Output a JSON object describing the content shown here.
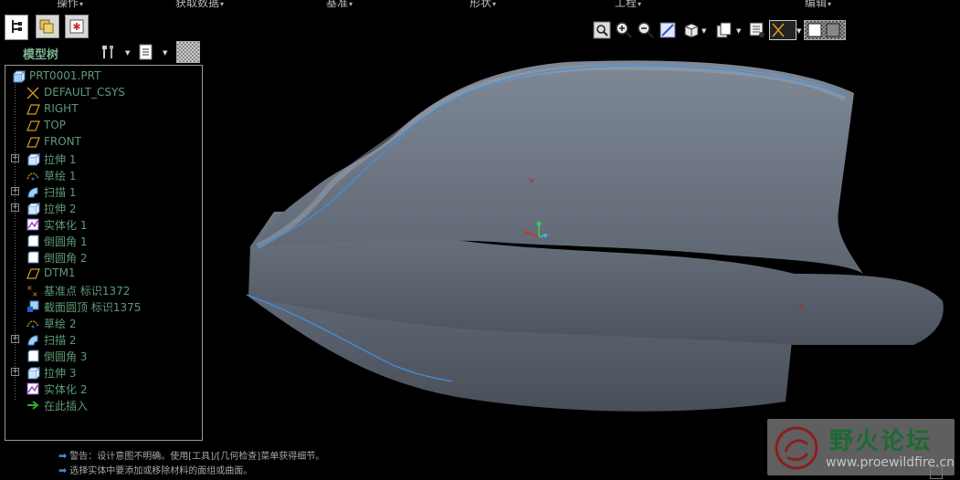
{
  "menu": [
    {
      "label": "操作"
    },
    {
      "label": "获取数据"
    },
    {
      "label": "基准"
    },
    {
      "label": "形状"
    },
    {
      "label": "工程"
    },
    {
      "label": "编辑"
    }
  ],
  "panel": {
    "title": "模型树",
    "tabs": [
      "model-tree-tab",
      "folder-browser-tab",
      "favorites-tab"
    ]
  },
  "tree": [
    {
      "label": "PRT0001.PRT",
      "icon": "part-icon",
      "expander": false,
      "indent": 0
    },
    {
      "label": "DEFAULT_CSYS",
      "icon": "csys-icon",
      "expander": false,
      "indent": 1
    },
    {
      "label": "RIGHT",
      "icon": "datum-plane-icon",
      "expander": false,
      "indent": 1
    },
    {
      "label": "TOP",
      "icon": "datum-plane-icon",
      "expander": false,
      "indent": 1
    },
    {
      "label": "FRONT",
      "icon": "datum-plane-icon",
      "expander": false,
      "indent": 1
    },
    {
      "label": "拉伸 1",
      "icon": "extrude-icon",
      "expander": true,
      "indent": 1
    },
    {
      "label": "草绘 1",
      "icon": "sketch-icon",
      "expander": false,
      "indent": 1
    },
    {
      "label": "扫描 1",
      "icon": "sweep-icon",
      "expander": true,
      "indent": 1
    },
    {
      "label": "拉伸 2",
      "icon": "extrude-icon",
      "expander": true,
      "indent": 1
    },
    {
      "label": "实体化 1",
      "icon": "solidify-icon",
      "expander": false,
      "indent": 1
    },
    {
      "label": "倒圆角 1",
      "icon": "round-icon",
      "expander": false,
      "indent": 1
    },
    {
      "label": "倒圆角 2",
      "icon": "round-icon",
      "expander": false,
      "indent": 1
    },
    {
      "label": "DTM1",
      "icon": "datum-plane-icon",
      "expander": false,
      "indent": 1
    },
    {
      "label": "基准点 标识1372",
      "icon": "datum-point-icon",
      "expander": false,
      "indent": 1
    },
    {
      "label": "截面圆顶 标识1375",
      "icon": "section-dome-icon",
      "expander": false,
      "indent": 1
    },
    {
      "label": "草绘 2",
      "icon": "sketch-icon",
      "expander": false,
      "indent": 1
    },
    {
      "label": "扫描 2",
      "icon": "sweep-icon",
      "expander": true,
      "indent": 1
    },
    {
      "label": "倒圆角 3",
      "icon": "round-icon",
      "expander": false,
      "indent": 1
    },
    {
      "label": "拉伸 3",
      "icon": "extrude-icon",
      "expander": true,
      "indent": 1
    },
    {
      "label": "实体化 2",
      "icon": "solidify-icon",
      "expander": false,
      "indent": 1
    },
    {
      "label": "在此插入",
      "icon": "insert-here-arrow-icon",
      "expander": false,
      "indent": 1
    }
  ],
  "toolbar": [
    "zoom-fit-icon",
    "zoom-in-icon",
    "zoom-out-icon",
    "repaint-icon",
    "orient-icon",
    "saved-views-icon",
    "layers-icon",
    "datum-display-icon",
    "display-style-icon"
  ],
  "messages": [
    "警告：设计意图不明确。使用[工具]/[几何检查]菜单获得细节。",
    "选择实体中要添加或移除材料的面组或曲面。"
  ],
  "watermark": {
    "title": "野火论坛",
    "url": "www.proewildfire.cn"
  },
  "colors": {
    "background": "#000000",
    "tree_text": "#5f9a78",
    "model_surface": "#6b7380",
    "edge_highlight": "#3f8fe0"
  }
}
